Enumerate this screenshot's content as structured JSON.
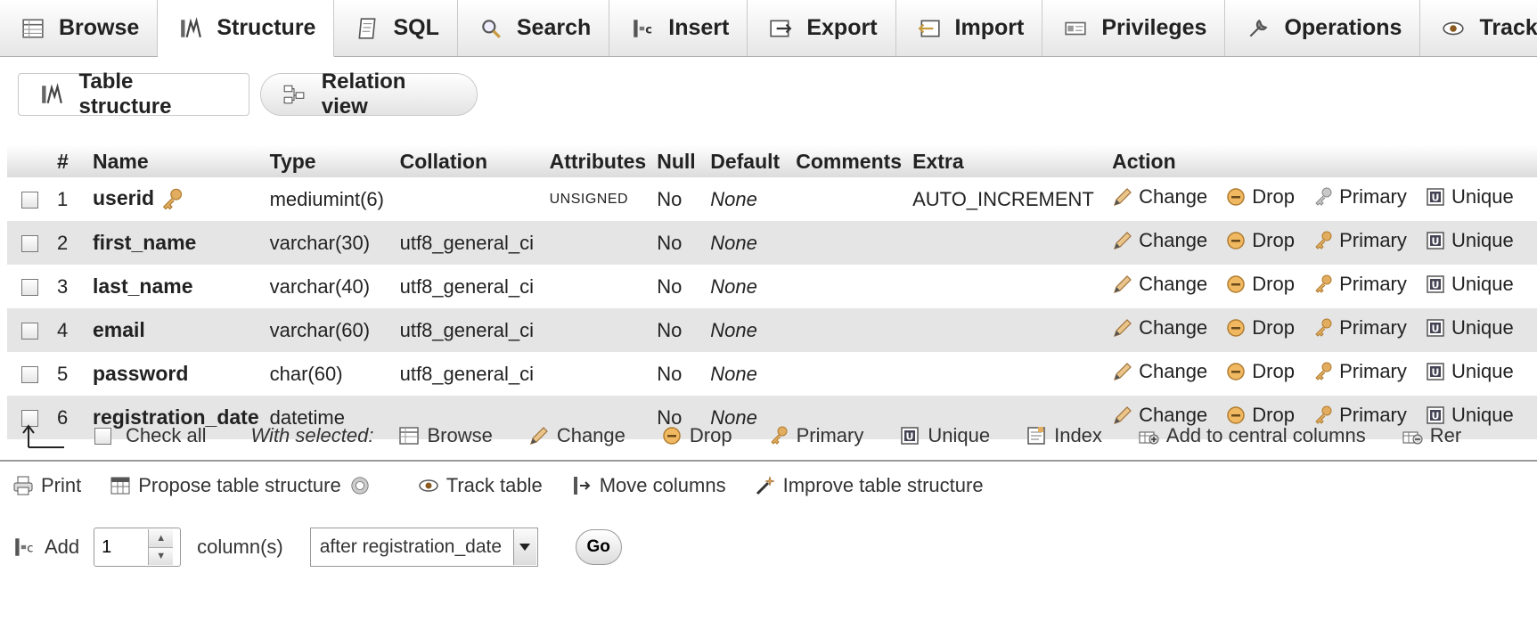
{
  "tabs": [
    {
      "label": "Browse",
      "icon": "table-icon"
    },
    {
      "label": "Structure",
      "icon": "structure-icon",
      "active": true
    },
    {
      "label": "SQL",
      "icon": "sql-icon"
    },
    {
      "label": "Search",
      "icon": "search-icon"
    },
    {
      "label": "Insert",
      "icon": "insert-icon"
    },
    {
      "label": "Export",
      "icon": "export-icon"
    },
    {
      "label": "Import",
      "icon": "import-icon"
    },
    {
      "label": "Privileges",
      "icon": "privileges-icon"
    },
    {
      "label": "Operations",
      "icon": "wrench-icon"
    },
    {
      "label": "Tracking",
      "icon": "eye-icon"
    }
  ],
  "subtabs": {
    "table_structure": "Table structure",
    "relation_view": "Relation view"
  },
  "columns": {
    "num": "#",
    "name": "Name",
    "type": "Type",
    "collation": "Collation",
    "attributes": "Attributes",
    "null": "Null",
    "default": "Default",
    "comments": "Comments",
    "extra": "Extra",
    "action": "Action"
  },
  "rows": [
    {
      "num": "1",
      "name": "userid",
      "type": "mediumint(6)",
      "collation": "",
      "attributes": "UNSIGNED",
      "null": "No",
      "default": "None",
      "comments": "",
      "extra": "AUTO_INCREMENT",
      "primary_key": true
    },
    {
      "num": "2",
      "name": "first_name",
      "type": "varchar(30)",
      "collation": "utf8_general_ci",
      "attributes": "",
      "null": "No",
      "default": "None",
      "comments": "",
      "extra": "",
      "primary_key": false
    },
    {
      "num": "3",
      "name": "last_name",
      "type": "varchar(40)",
      "collation": "utf8_general_ci",
      "attributes": "",
      "null": "No",
      "default": "None",
      "comments": "",
      "extra": "",
      "primary_key": false
    },
    {
      "num": "4",
      "name": "email",
      "type": "varchar(60)",
      "collation": "utf8_general_ci",
      "attributes": "",
      "null": "No",
      "default": "None",
      "comments": "",
      "extra": "",
      "primary_key": false
    },
    {
      "num": "5",
      "name": "password",
      "type": "char(60)",
      "collation": "utf8_general_ci",
      "attributes": "",
      "null": "No",
      "default": "None",
      "comments": "",
      "extra": "",
      "primary_key": false
    },
    {
      "num": "6",
      "name": "registration_date",
      "type": "datetime",
      "collation": "",
      "attributes": "",
      "null": "No",
      "default": "None",
      "comments": "",
      "extra": "",
      "primary_key": false
    }
  ],
  "row_actions": {
    "change": "Change",
    "drop": "Drop",
    "primary": "Primary",
    "unique": "Unique"
  },
  "selected_bar": {
    "check_all": "Check all",
    "with_selected": "With selected:",
    "browse": "Browse",
    "change": "Change",
    "drop": "Drop",
    "primary": "Primary",
    "unique": "Unique",
    "index": "Index",
    "add_central": "Add to central columns",
    "remove_partial": "Rer"
  },
  "links": {
    "print": "Print",
    "propose": "Propose table structure",
    "track": "Track table",
    "move": "Move columns",
    "improve": "Improve table structure"
  },
  "add_row": {
    "add_label": "Add",
    "count": "1",
    "columns_label": "column(s)",
    "position": "after registration_date",
    "go": "Go"
  },
  "colors": {
    "row_even": "#e5e5e5",
    "key_gold": "#d9a45a",
    "drop_orange": "#e0a040"
  }
}
